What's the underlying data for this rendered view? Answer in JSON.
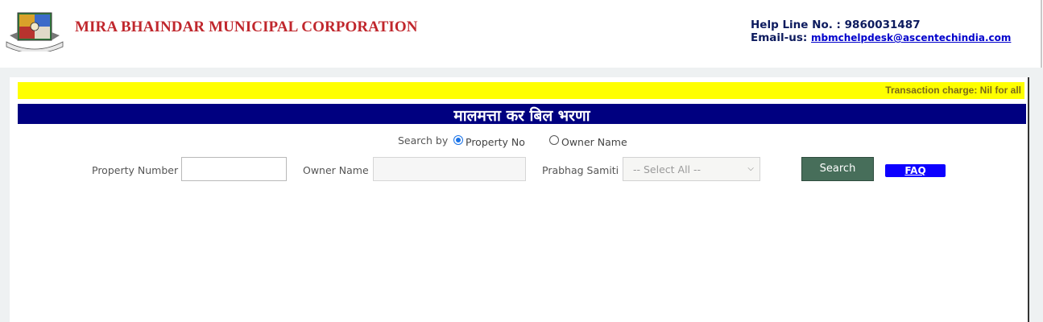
{
  "header": {
    "org_name": "MIRA BHAINDAR MUNICIPAL CORPORATION",
    "helpline_label": "Help Line No. : ",
    "helpline_number": "9860031487",
    "email_label": "Email-us: ",
    "email": "mbmchelpdesk@ascentechindia.com"
  },
  "banner": {
    "transaction_charge": "Transaction charge: Nil for all"
  },
  "page_title": "मालमत्ता कर बिल भरणा",
  "search": {
    "search_by_label": "Search by",
    "option_property": "Property No",
    "option_owner": "Owner Name",
    "selected_option": "Property No",
    "property_number_label": "Property Number :",
    "property_number_value": "",
    "owner_name_label": "Owner Name :",
    "owner_name_value": "",
    "prabhag_label": "Prabhag Samiti :",
    "prabhag_selected": "-- Select All --",
    "search_button": "Search",
    "faq_button": "FAQ"
  },
  "colors": {
    "org_name": "#c0272d",
    "yellow_bar": "#ffff00",
    "title_bar": "#000080",
    "search_button": "#476e5a",
    "faq_button": "#0d00ff"
  }
}
